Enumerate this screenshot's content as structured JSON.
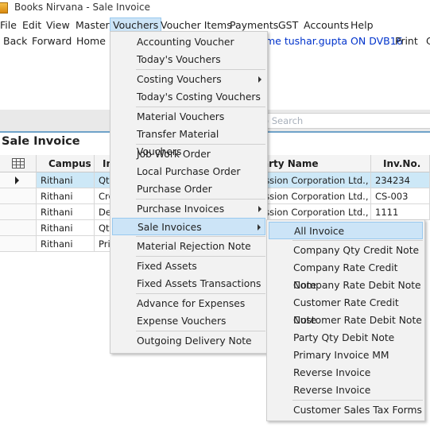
{
  "window": {
    "title": "Books Nirvana - Sale Invoice"
  },
  "menubar": [
    "File",
    "Edit",
    "View",
    "Master",
    "Vouchers",
    "Voucher Items",
    "Payments",
    "GST",
    "Accounts",
    "Help"
  ],
  "toolbar": {
    "back": "Back",
    "forward": "Forward",
    "home": "Home",
    "user_info": "me tushar.gupta ON DVB16",
    "print": "Print",
    "extra": "C"
  },
  "search": {
    "placeholder": "o Search"
  },
  "page": {
    "heading": "Sale Invoice"
  },
  "grid": {
    "headers": {
      "campus": "Campus",
      "type": "In",
      "party": "arty Name",
      "invno": "Inv.No."
    },
    "rows": [
      {
        "campus": "Rithani",
        "type": "Qty",
        "party": "ission Corporation Ltd., E",
        "invno": "234234"
      },
      {
        "campus": "Rithani",
        "type": "Cre",
        "party": "ission Corporation Ltd., E",
        "invno": "CS-003"
      },
      {
        "campus": "Rithani",
        "type": "De",
        "party": "ission Corporation Ltd., E",
        "invno": "1111"
      },
      {
        "campus": "Rithani",
        "type": "Qty",
        "party": "",
        "invno": ""
      },
      {
        "campus": "Rithani",
        "type": "Prin",
        "party": "",
        "invno": ""
      }
    ]
  },
  "vouchers_menu": {
    "groups": [
      [
        "Accounting Voucher",
        "Today's Vouchers"
      ],
      [
        "Costing Vouchers",
        "Today's Costing Vouchers"
      ],
      [
        "Material Vouchers",
        "Transfer Material Vouchers"
      ],
      [
        "Job Work Order",
        "Local Purchase Order",
        "Purchase Order"
      ],
      [
        "Purchase Invoices",
        "Sale Invoices"
      ],
      [
        "Material Rejection Note"
      ],
      [
        "Fixed Assets",
        "Fixed Assets Transactions"
      ],
      [
        "Advance for Expenses",
        "Expense Vouchers"
      ],
      [
        "Outgoing Delivery Note"
      ]
    ]
  },
  "sale_invoices_menu": {
    "groups": [
      [
        "All Invoice"
      ],
      [
        "Company Qty Credit Note",
        "Company Rate Credit Note",
        "Company Rate Debit Note",
        "Customer Rate Credit Note",
        "Customer Rate Debit Note",
        "Party Qty Debit Note",
        "Primary Invoice MM",
        "Reverse Invoice",
        "Reverse Invoice"
      ],
      [
        "Customer Sales Tax Forms"
      ]
    ]
  },
  "colors": {
    "highlight": "#cce4f7",
    "highlight_border": "#99c9ef",
    "menu_bg": "#f2f2f2",
    "selected_row": "#cde8f7",
    "accent_line": "#6fa3c9",
    "user_text": "#0033cc"
  }
}
